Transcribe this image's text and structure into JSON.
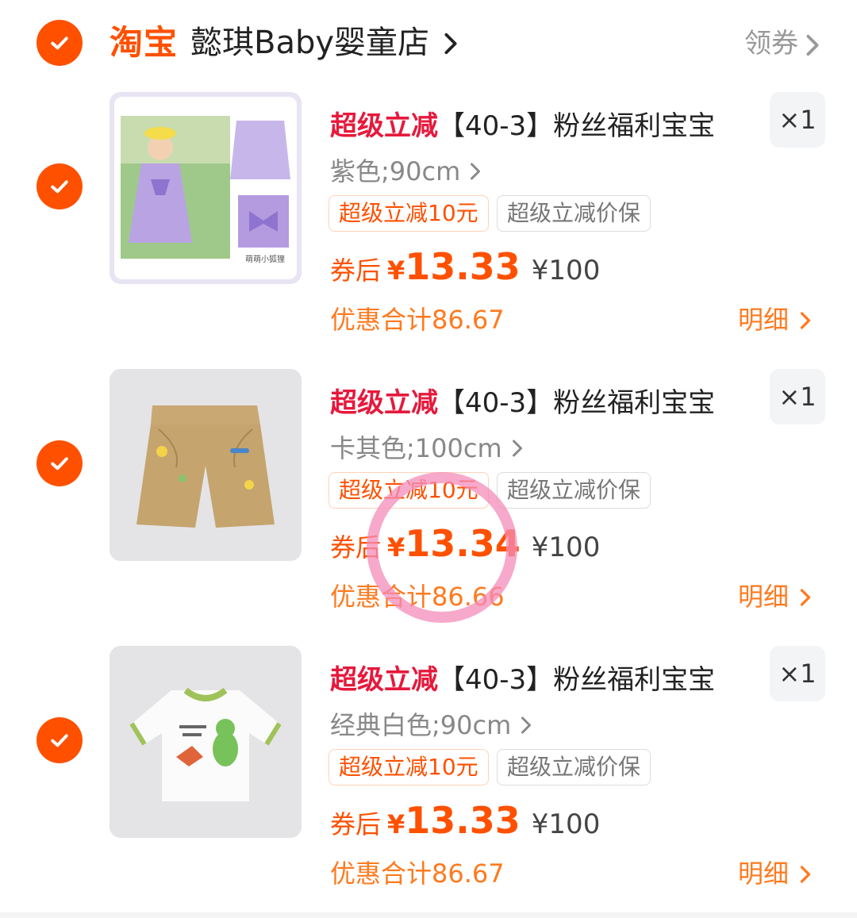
{
  "shop": {
    "logo": "淘宝",
    "name": "懿琪Baby婴童店",
    "coupon_link": "领券"
  },
  "items": [
    {
      "promo_tag": "超级立减",
      "title": "【40-3】粉丝福利宝宝",
      "sku": "紫色;90cm",
      "qty": "×1",
      "badge_discount": "超级立减10元",
      "badge_guarantee": "超级立减价保",
      "price_label": "券后",
      "price_currency": "¥",
      "price_value": "13.33",
      "original_price": "¥100",
      "discount_total": "优惠合计86.67",
      "detail_link": "明细",
      "thumb_caption": "萌萌小狐狸"
    },
    {
      "promo_tag": "超级立减",
      "title": "【40-3】粉丝福利宝宝",
      "sku": "卡其色;100cm",
      "qty": "×1",
      "badge_discount": "超级立减10元",
      "badge_guarantee": "超级立减价保",
      "price_label": "券后",
      "price_currency": "¥",
      "price_value": "13.34",
      "original_price": "¥100",
      "discount_total": "优惠合计86.66",
      "detail_link": "明细"
    },
    {
      "promo_tag": "超级立减",
      "title": "【40-3】粉丝福利宝宝",
      "sku": "经典白色;90cm",
      "qty": "×1",
      "badge_discount": "超级立减10元",
      "badge_guarantee": "超级立减价保",
      "price_label": "券后",
      "price_currency": "¥",
      "price_value": "13.33",
      "original_price": "¥100",
      "discount_total": "优惠合计86.67",
      "detail_link": "明细"
    }
  ],
  "colors": {
    "brand_orange": "#ff5000",
    "promo_red": "#e6193c",
    "discount_orange": "#ff7a1f",
    "highlight_pink": "#f48cb9"
  },
  "icons": {
    "check": "check-icon",
    "chevron": "chevron-right-icon"
  }
}
